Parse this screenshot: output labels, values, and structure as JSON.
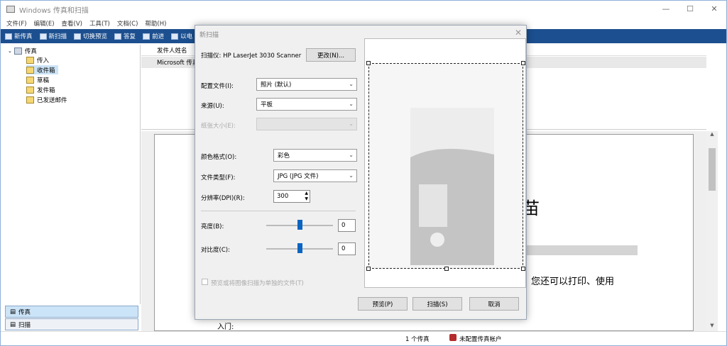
{
  "window": {
    "title": "Windows 传真和扫描",
    "controls": [
      "—",
      "☐",
      "✕"
    ]
  },
  "menu": [
    "文件(F)",
    "编辑(E)",
    "查看(V)",
    "工具(T)",
    "文档(C)",
    "帮助(H)"
  ],
  "toolbar": [
    {
      "label": "新传真",
      "icon": "new-fax-icon"
    },
    {
      "label": "新扫描",
      "icon": "new-scan-icon"
    },
    {
      "label": "切换预览",
      "icon": "toggle-preview-icon"
    },
    {
      "label": "答复",
      "icon": "reply-icon"
    },
    {
      "label": "前进",
      "icon": "forward-icon"
    },
    {
      "label": "以电",
      "icon": "email-icon"
    }
  ],
  "tree": {
    "root": "传真",
    "items": [
      "传入",
      "收件箱",
      "草稿",
      "发件箱",
      "已发送邮件"
    ]
  },
  "nav_buttons": [
    "传真",
    "扫描"
  ],
  "list": {
    "header": "发件人姓名",
    "row": "Microsoft 传真"
  },
  "preview_doc": {
    "heading_fragment": "苗",
    "line_fragment": "您还可以打印、使用",
    "intro": "入门:"
  },
  "status": {
    "count": "1 个传真",
    "account": "未配置传真帐户"
  },
  "dialog": {
    "title": "新扫描",
    "scanner_label": "扫描仪: HP LaserJet 3030 Scanner",
    "change_button": "更改(N)...",
    "profile_label": "配置文件(I):",
    "profile_value": "照片 (默认)",
    "source_label": "来源(U):",
    "source_value": "平板",
    "paper_size_label": "纸张大小(E):",
    "color_label": "颜色格式(O):",
    "color_value": "彩色",
    "filetype_label": "文件类型(F):",
    "filetype_value": "JPG (JPG 文件)",
    "dpi_label": "分辨率(DPI)(R):",
    "dpi_value": "300",
    "brightness_label": "亮度(B):",
    "brightness_value": "0",
    "contrast_label": "对比度(C):",
    "contrast_value": "0",
    "separate_files_label": "预览或将图像扫描为单独的文件(T)",
    "preview_button": "预览(P)",
    "scan_button": "扫描(S)",
    "cancel_button": "取消"
  },
  "colors": {
    "toolbar_bg": "#1c4f8f",
    "selected_bg": "#cce4f7",
    "slider_thumb": "#0a64c2"
  }
}
